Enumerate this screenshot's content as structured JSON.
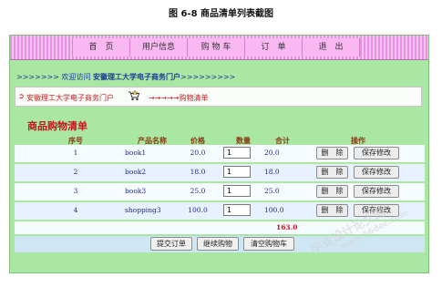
{
  "caption": "图 6-8  商品清单列表截图",
  "nav": {
    "items": [
      "首　页",
      "用户信息",
      "购 物 车",
      "订　单",
      "退　出"
    ]
  },
  "welcome": {
    "prefix": ">>>>>>> 欢迎访问",
    "site": "安徽理工大学电子商务门户",
    "suffix": ">>>>>>>>>"
  },
  "crumb": {
    "home": "安徽理工大学电子商务门户",
    "path": "→→→→→购物清单"
  },
  "cart": {
    "title": "商品购物清单",
    "headers": [
      "序号",
      "产品名称",
      "价格",
      "数量",
      "合计",
      "操作"
    ],
    "rows": [
      {
        "no": "1",
        "name": "book1",
        "price": "20.0",
        "qty": "1",
        "subtotal": "20.0"
      },
      {
        "no": "2",
        "name": "book2",
        "price": "18.0",
        "qty": "1",
        "subtotal": "18.0"
      },
      {
        "no": "3",
        "name": "book3",
        "price": "25.0",
        "qty": "1",
        "subtotal": "25.0"
      },
      {
        "no": "4",
        "name": "shopping3",
        "price": "100.0",
        "qty": "1",
        "subtotal": "100.0"
      }
    ],
    "delete_label": "删　除",
    "save_label": "保存修改",
    "total": "163.0"
  },
  "actions": {
    "submit": "提交订单",
    "continue": "继续购物",
    "clear": "清空购物车"
  },
  "watermark": {
    "text": "毕业设计论文网",
    "url": "www.56doc.com"
  }
}
